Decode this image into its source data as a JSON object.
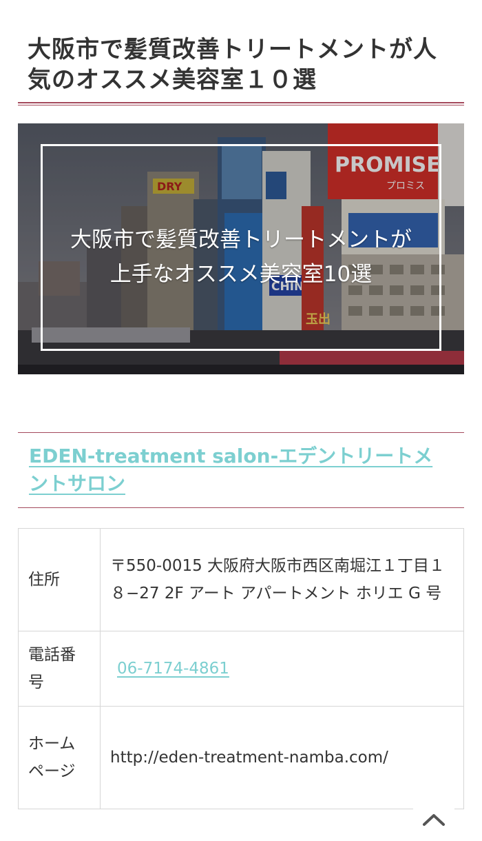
{
  "page": {
    "title": "大阪市で髪質改善トリートメントが人気のオススメ美容室１０選"
  },
  "hero": {
    "caption_line1": "大阪市で髪質改善トリートメントが",
    "caption_line2": "上手なオススメ美容室10選",
    "signs": {
      "promise": "PROMISE",
      "promise_sub": "プロミス",
      "dry": "DRY",
      "chintai": "CHINTAI",
      "bottom_sign": "玉出"
    }
  },
  "salon": {
    "name": "EDEN-treatment salon-エデントリートメントサロン",
    "rows": [
      {
        "key": "住所",
        "value": "〒550-0015 大阪府大阪市西区南堀江１丁目１８−27 2F アート アパートメント ホリエ G 号"
      },
      {
        "key": "電話番号",
        "value": "06-7174-4861"
      },
      {
        "key": "ホームページ",
        "value": "http://eden-treatment-namba.com/"
      }
    ]
  },
  "colors": {
    "accent_rule": "#a3485b",
    "link": "#7ccfd0"
  },
  "icons": {
    "back_to_top": "chevron-up-icon"
  }
}
